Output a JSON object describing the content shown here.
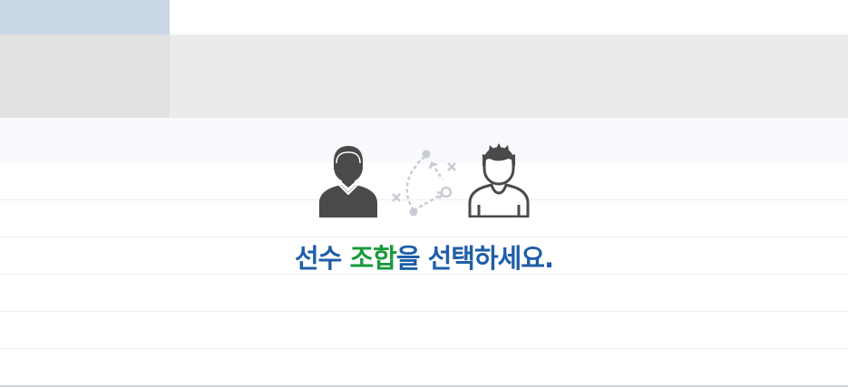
{
  "empty_state": {
    "message_part1": "선수 ",
    "message_accent": "조합",
    "message_part2": "을 선택하세요.",
    "icons": [
      "player-icon",
      "tactic-board-icon",
      "player-icon"
    ]
  },
  "colors": {
    "tab_active": "#cad8e8",
    "band_gray": "#ebebeb",
    "text_blue": "#1f5ea8",
    "text_green": "#1a9a3c",
    "icon_dark": "#4a4a4a",
    "icon_light": "#c8ccd2"
  }
}
